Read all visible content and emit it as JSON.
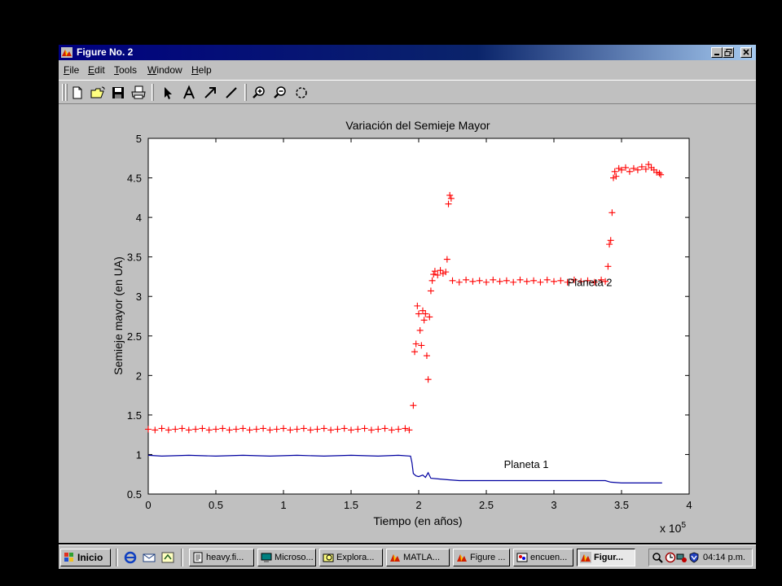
{
  "window": {
    "title": "Figure No. 2",
    "menus": [
      "File",
      "Edit",
      "Tools",
      "Window",
      "Help"
    ]
  },
  "toolbar": {
    "icons": [
      "new-figure-icon",
      "open-file-icon",
      "save-icon",
      "print-icon",
      "select-arrow-icon",
      "insert-text-icon",
      "insert-arrow-icon",
      "insert-line-icon",
      "zoom-in-icon",
      "zoom-out-icon",
      "rotate-3d-icon"
    ]
  },
  "chart_data": {
    "type": "line",
    "title": "Variación del Semieje Mayor",
    "xlabel": "Tiempo (en años)",
    "ylabel": "Semieje mayor (en UA)",
    "x_multiplier_label": "x 10",
    "x_multiplier_exp": "5",
    "xlim": [
      0,
      4
    ],
    "ylim": [
      0.5,
      5
    ],
    "xticks": [
      "0",
      "0.5",
      "1",
      "1.5",
      "2",
      "2.5",
      "3",
      "3.5",
      "4"
    ],
    "yticks": [
      "0.5",
      "1",
      "1.5",
      "2",
      "2.5",
      "3",
      "3.5",
      "4",
      "4.5",
      "5"
    ],
    "grid": false,
    "annotations": [
      {
        "text": "Planeta 2",
        "x": 3.1,
        "y": 3.18
      },
      {
        "text": "Planeta 1",
        "x": 2.63,
        "y": 0.88
      }
    ],
    "series": [
      {
        "name": "Planeta 1",
        "style": "line",
        "color": "#0000a0",
        "points": [
          [
            0,
            0.99
          ],
          [
            0.1,
            0.98
          ],
          [
            0.3,
            0.99
          ],
          [
            0.5,
            0.98
          ],
          [
            0.7,
            0.99
          ],
          [
            0.9,
            0.98
          ],
          [
            1.1,
            0.99
          ],
          [
            1.3,
            0.98
          ],
          [
            1.5,
            0.99
          ],
          [
            1.7,
            0.98
          ],
          [
            1.85,
            0.99
          ],
          [
            1.94,
            0.98
          ],
          [
            1.95,
            0.9
          ],
          [
            1.96,
            0.76
          ],
          [
            1.98,
            0.73
          ],
          [
            2.0,
            0.72
          ],
          [
            2.03,
            0.74
          ],
          [
            2.05,
            0.71
          ],
          [
            2.07,
            0.77
          ],
          [
            2.09,
            0.7
          ],
          [
            2.15,
            0.69
          ],
          [
            2.22,
            0.68
          ],
          [
            2.3,
            0.67
          ],
          [
            2.6,
            0.67
          ],
          [
            3.0,
            0.67
          ],
          [
            3.38,
            0.67
          ],
          [
            3.42,
            0.65
          ],
          [
            3.5,
            0.64
          ],
          [
            3.6,
            0.64
          ],
          [
            3.7,
            0.64
          ],
          [
            3.8,
            0.64
          ]
        ]
      },
      {
        "name": "Planeta 2",
        "style": "plus",
        "color": "#ff0000",
        "points": [
          [
            0.0,
            1.32
          ],
          [
            0.05,
            1.31
          ],
          [
            0.1,
            1.33
          ],
          [
            0.15,
            1.31
          ],
          [
            0.2,
            1.32
          ],
          [
            0.25,
            1.33
          ],
          [
            0.3,
            1.31
          ],
          [
            0.35,
            1.32
          ],
          [
            0.4,
            1.33
          ],
          [
            0.45,
            1.31
          ],
          [
            0.5,
            1.32
          ],
          [
            0.55,
            1.33
          ],
          [
            0.6,
            1.31
          ],
          [
            0.65,
            1.32
          ],
          [
            0.7,
            1.33
          ],
          [
            0.75,
            1.31
          ],
          [
            0.8,
            1.32
          ],
          [
            0.85,
            1.33
          ],
          [
            0.9,
            1.31
          ],
          [
            0.95,
            1.32
          ],
          [
            1.0,
            1.33
          ],
          [
            1.05,
            1.31
          ],
          [
            1.1,
            1.32
          ],
          [
            1.15,
            1.33
          ],
          [
            1.2,
            1.31
          ],
          [
            1.25,
            1.32
          ],
          [
            1.3,
            1.33
          ],
          [
            1.35,
            1.31
          ],
          [
            1.4,
            1.32
          ],
          [
            1.45,
            1.33
          ],
          [
            1.5,
            1.31
          ],
          [
            1.55,
            1.32
          ],
          [
            1.6,
            1.33
          ],
          [
            1.65,
            1.31
          ],
          [
            1.7,
            1.32
          ],
          [
            1.75,
            1.33
          ],
          [
            1.8,
            1.31
          ],
          [
            1.85,
            1.32
          ],
          [
            1.9,
            1.33
          ],
          [
            1.93,
            1.31
          ],
          [
            1.96,
            1.62
          ],
          [
            1.97,
            2.3
          ],
          [
            1.98,
            2.4
          ],
          [
            1.99,
            2.88
          ],
          [
            2.0,
            2.78
          ],
          [
            2.01,
            2.57
          ],
          [
            2.02,
            2.38
          ],
          [
            2.03,
            2.82
          ],
          [
            2.04,
            2.7
          ],
          [
            2.05,
            2.78
          ],
          [
            2.06,
            2.25
          ],
          [
            2.07,
            1.95
          ],
          [
            2.08,
            2.74
          ],
          [
            2.09,
            3.07
          ],
          [
            2.1,
            3.2
          ],
          [
            2.11,
            3.28
          ],
          [
            2.12,
            3.32
          ],
          [
            2.14,
            3.27
          ],
          [
            2.16,
            3.33
          ],
          [
            2.18,
            3.29
          ],
          [
            2.2,
            3.31
          ],
          [
            2.21,
            3.47
          ],
          [
            2.22,
            4.17
          ],
          [
            2.23,
            4.28
          ],
          [
            2.24,
            4.24
          ],
          [
            2.25,
            3.2
          ],
          [
            2.3,
            3.18
          ],
          [
            2.35,
            3.21
          ],
          [
            2.4,
            3.19
          ],
          [
            2.45,
            3.2
          ],
          [
            2.5,
            3.18
          ],
          [
            2.55,
            3.21
          ],
          [
            2.6,
            3.19
          ],
          [
            2.65,
            3.2
          ],
          [
            2.7,
            3.18
          ],
          [
            2.75,
            3.21
          ],
          [
            2.8,
            3.19
          ],
          [
            2.85,
            3.2
          ],
          [
            2.9,
            3.18
          ],
          [
            2.95,
            3.21
          ],
          [
            3.0,
            3.19
          ],
          [
            3.05,
            3.2
          ],
          [
            3.1,
            3.18
          ],
          [
            3.15,
            3.21
          ],
          [
            3.2,
            3.19
          ],
          [
            3.25,
            3.2
          ],
          [
            3.3,
            3.18
          ],
          [
            3.35,
            3.21
          ],
          [
            3.38,
            3.19
          ],
          [
            3.4,
            3.38
          ],
          [
            3.41,
            3.66
          ],
          [
            3.42,
            3.71
          ],
          [
            3.43,
            4.06
          ],
          [
            3.44,
            4.5
          ],
          [
            3.45,
            4.58
          ],
          [
            3.46,
            4.52
          ],
          [
            3.48,
            4.62
          ],
          [
            3.5,
            4.6
          ],
          [
            3.53,
            4.63
          ],
          [
            3.56,
            4.58
          ],
          [
            3.59,
            4.62
          ],
          [
            3.62,
            4.6
          ],
          [
            3.65,
            4.64
          ],
          [
            3.68,
            4.61
          ],
          [
            3.7,
            4.67
          ],
          [
            3.72,
            4.63
          ],
          [
            3.74,
            4.6
          ],
          [
            3.76,
            4.57
          ],
          [
            3.78,
            4.56
          ],
          [
            3.79,
            4.54
          ]
        ]
      }
    ]
  },
  "taskbar": {
    "start_label": "Inicio",
    "buttons": [
      {
        "label": "heavy.fi...",
        "icon": "text-file-icon"
      },
      {
        "label": "Microso...",
        "icon": "monitor-icon"
      },
      {
        "label": "Explora...",
        "icon": "explorer-icon"
      },
      {
        "label": "MATLA...",
        "icon": "matlab-icon"
      },
      {
        "label": "Figure ...",
        "icon": "figure-icon"
      },
      {
        "label": "encuen...",
        "icon": "paint-icon"
      },
      {
        "label": "Figur...",
        "icon": "figure-icon"
      }
    ],
    "clock": "04:14 p.m."
  }
}
